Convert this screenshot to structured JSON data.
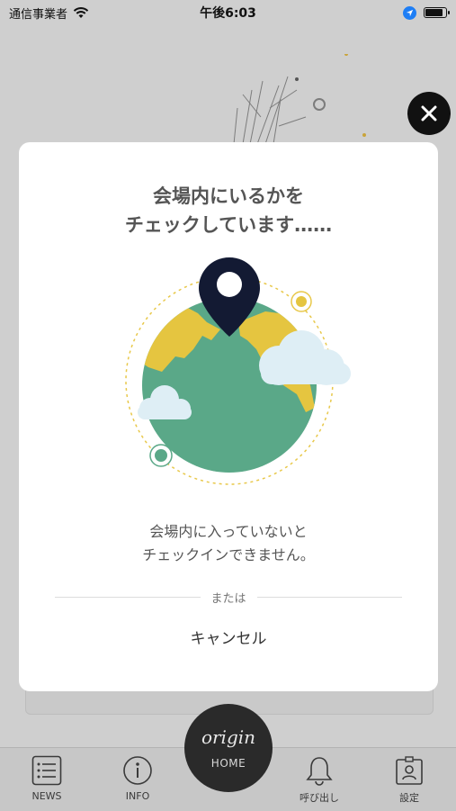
{
  "status_bar": {
    "carrier": "通信事業者",
    "time": "午後6:03",
    "battery_percent": 95
  },
  "modal": {
    "title_line1": "会場内にいるかを",
    "title_line2": "チェックしています……",
    "message_line1": "会場内に入っていないと",
    "message_line2": "チェックインできません。",
    "divider_text": "または",
    "cancel_label": "キャンセル"
  },
  "tabbar": {
    "news": "NEWS",
    "info": "INFO",
    "home": "HOME",
    "home_logo": "origin",
    "call": "呼び出し",
    "settings": "設定"
  },
  "colors": {
    "globe_ocean": "#5aa888",
    "globe_land": "#e5c540",
    "pin": "#131a33",
    "cloud": "#deeef5",
    "orbit": "#e8c84a"
  }
}
